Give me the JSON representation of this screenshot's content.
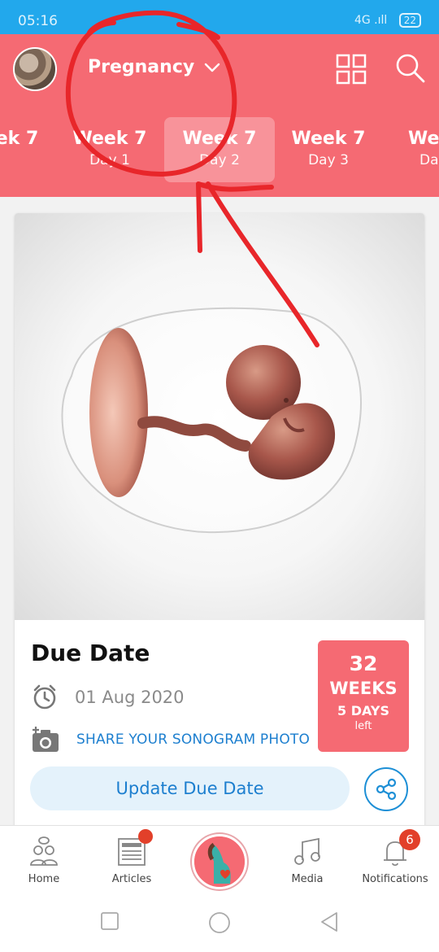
{
  "status_bar": {
    "time": "05:16",
    "signal": "4G .ıll",
    "battery": "22"
  },
  "header": {
    "mode_label": "Pregnancy"
  },
  "week_strip": [
    {
      "week": "ek 7",
      "day": ""
    },
    {
      "week": "Week 7",
      "day": "Day 1"
    },
    {
      "week": "Week 7",
      "day": "Day 2",
      "selected": true
    },
    {
      "week": "Week 7",
      "day": "Day 3"
    },
    {
      "week": "Wee",
      "day": "Da"
    }
  ],
  "card": {
    "title": "Due Date",
    "due_date": "01 Aug 2020",
    "share_link": "SHARE YOUR SONOGRAM PHOTO",
    "countdown": {
      "number": "32",
      "unit": "WEEKS",
      "days": "5 DAYS",
      "suffix": "left"
    },
    "update_button": "Update Due Date"
  },
  "bottom_nav": {
    "home": "Home",
    "articles": "Articles",
    "media": "Media",
    "notifications": "Notifications",
    "notifications_count": "6"
  },
  "colors": {
    "status_bar": "#22a8ec",
    "brand_coral": "#f56a73",
    "link_blue": "#1d7fcf",
    "annotation_red": "#e8262a"
  },
  "icons": [
    "grid-icon",
    "search-icon",
    "chevron-down-icon",
    "clock-icon",
    "camera-add-icon",
    "share-icon",
    "home-icon",
    "articles-icon",
    "media-icon",
    "bell-icon"
  ]
}
